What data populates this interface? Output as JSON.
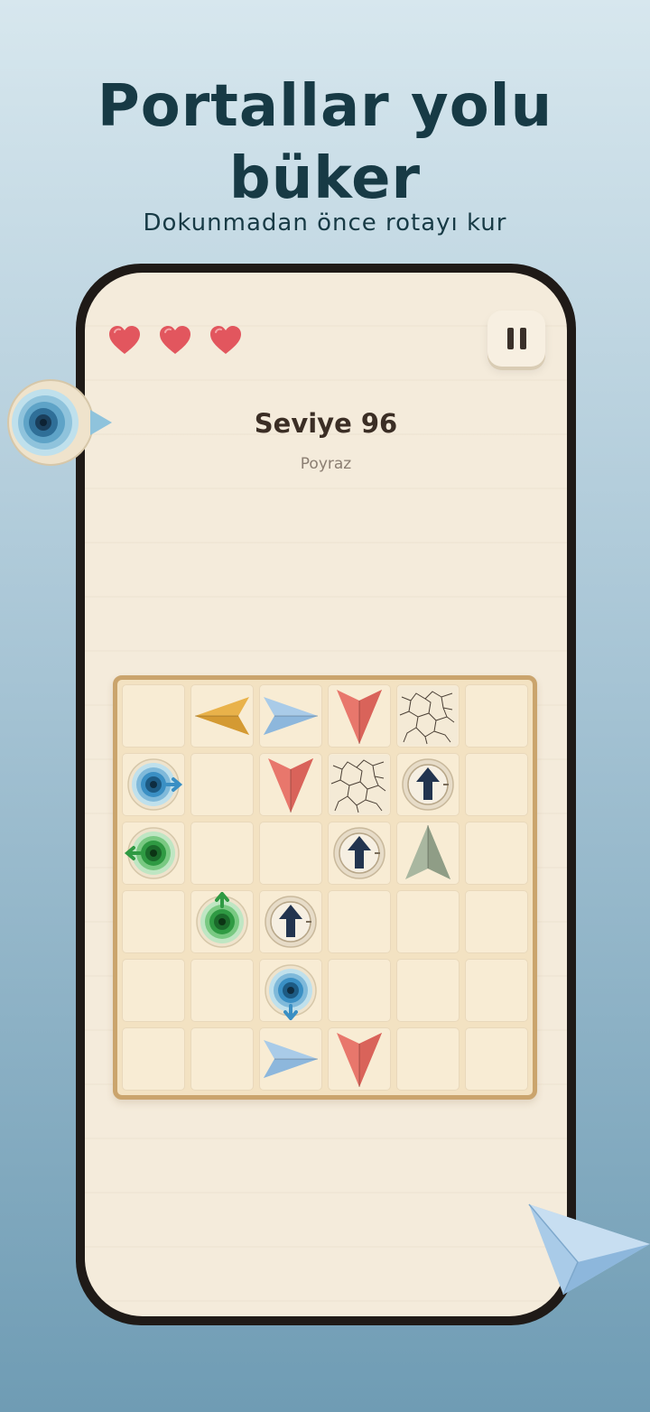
{
  "promo": {
    "headline_line1": "Portallar yolu",
    "headline_line2": "büker",
    "subtitle": "Dokunmadan önce rotayı kur"
  },
  "game": {
    "lives": 3,
    "level_title": "Seviye 96",
    "level_subtitle": "Poyraz",
    "pause_icon": "pause-icon"
  },
  "board": {
    "rows": 6,
    "cols": 6,
    "cells": [
      [
        "empty",
        "plane-yellow-left",
        "plane-blue-right",
        "plane-red-down",
        "cracked",
        "empty"
      ],
      [
        "portal-blue-right",
        "empty",
        "plane-red-down",
        "cracked",
        "arrow-up-tile",
        "empty"
      ],
      [
        "portal-green-left",
        "empty",
        "empty",
        "arrow-up-tile",
        "plane-gray-up",
        "empty"
      ],
      [
        "empty",
        "portal-green-up",
        "arrow-up-tile",
        "empty",
        "empty",
        "empty"
      ],
      [
        "empty",
        "empty",
        "portal-blue-down",
        "empty",
        "empty",
        "empty"
      ],
      [
        "empty",
        "empty",
        "plane-blue-right",
        "plane-red-down",
        "empty",
        "empty"
      ]
    ]
  },
  "colors": {
    "heart": "#e2565e",
    "plane_yellow": "#e9b24a",
    "plane_blue": "#a9cbe8",
    "plane_red": "#e8776c",
    "plane_gray": "#a9b7a0",
    "portal_blue": "#3a8fc4",
    "portal_green": "#2f9a43",
    "arrow_navy": "#22344f"
  }
}
